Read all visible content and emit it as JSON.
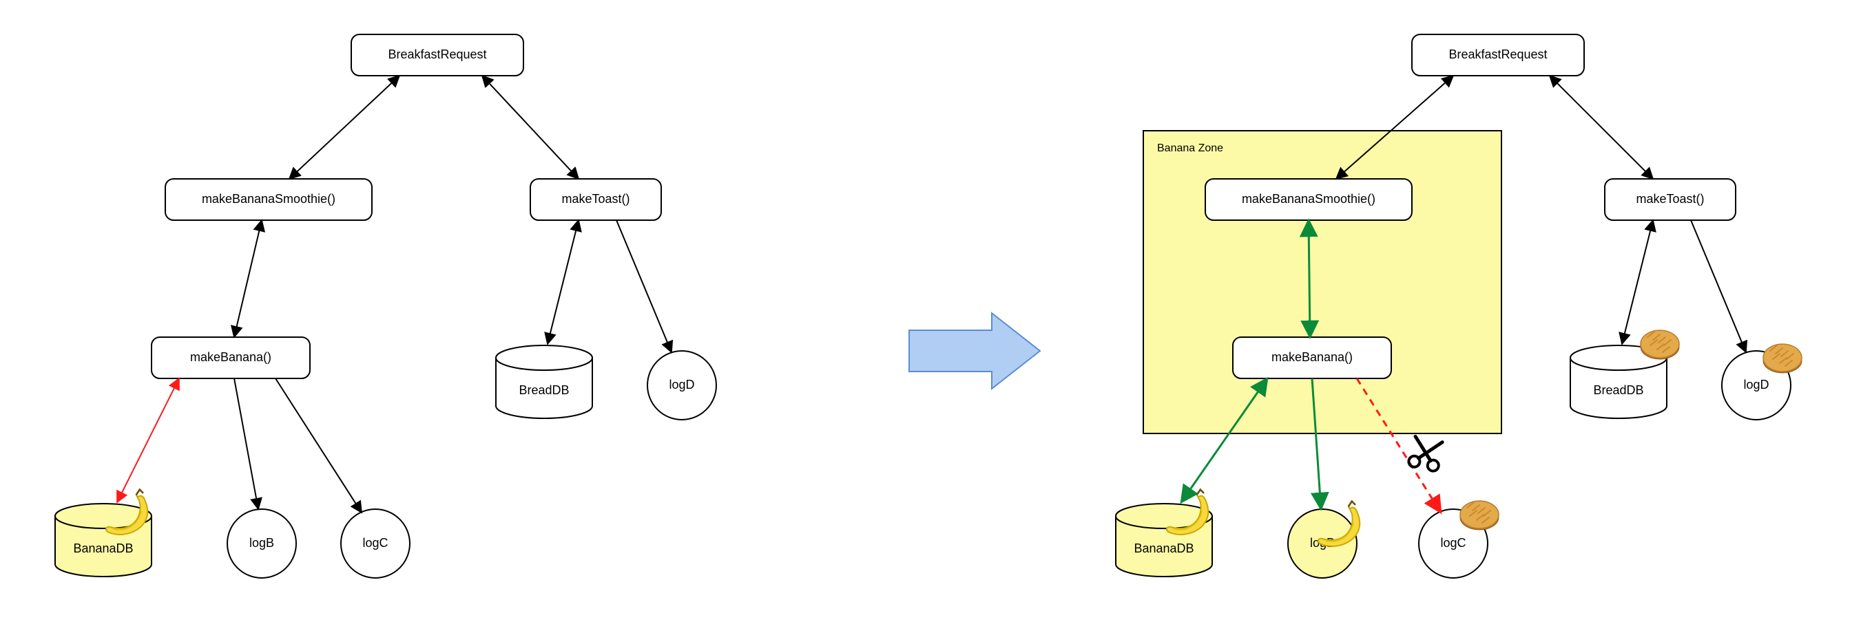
{
  "diagram": {
    "left": {
      "root": "BreakfastRequest",
      "smoothie": "makeBananaSmoothie()",
      "toast": "makeToast()",
      "banana": "makeBanana()",
      "bananaDB": "BananaDB",
      "logB": "logB",
      "logC": "logC",
      "breadDB": "BreadDB",
      "logD": "logD"
    },
    "right": {
      "zone": "Banana Zone",
      "root": "BreakfastRequest",
      "smoothie": "makeBananaSmoothie()",
      "toast": "makeToast()",
      "banana": "makeBanana()",
      "bananaDB": "BananaDB",
      "logB": "logB",
      "logC": "logC",
      "breadDB": "BreadDB",
      "logD": "logD"
    },
    "icons": {
      "banana": "banana-icon",
      "bread": "bread-icon",
      "scissors": "scissors-icon"
    },
    "colors": {
      "zone_fill": "#fdfaa7",
      "arrow_red": "#ff1a1a",
      "arrow_green": "#0b8a3a",
      "transition_arrow": "#b0cdf3"
    },
    "edges_left": [
      {
        "from": "root",
        "to": "smoothie",
        "style": "bidir-black"
      },
      {
        "from": "root",
        "to": "toast",
        "style": "bidir-black"
      },
      {
        "from": "smoothie",
        "to": "banana",
        "style": "bidir-black"
      },
      {
        "from": "banana",
        "to": "bananaDB",
        "style": "bidir-red"
      },
      {
        "from": "banana",
        "to": "logB",
        "style": "single-black"
      },
      {
        "from": "banana",
        "to": "logC",
        "style": "single-black"
      },
      {
        "from": "toast",
        "to": "breadDB",
        "style": "bidir-black"
      },
      {
        "from": "toast",
        "to": "logD",
        "style": "single-black"
      }
    ],
    "edges_right": [
      {
        "from": "root",
        "to": "smoothie",
        "style": "bidir-black"
      },
      {
        "from": "root",
        "to": "toast",
        "style": "bidir-black"
      },
      {
        "from": "smoothie",
        "to": "banana",
        "style": "bidir-green"
      },
      {
        "from": "banana",
        "to": "bananaDB",
        "style": "bidir-green"
      },
      {
        "from": "banana",
        "to": "logB",
        "style": "single-green"
      },
      {
        "from": "banana",
        "to": "logC",
        "style": "dashed-red-cut"
      },
      {
        "from": "toast",
        "to": "breadDB",
        "style": "bidir-black"
      },
      {
        "from": "toast",
        "to": "logD",
        "style": "single-black"
      }
    ]
  }
}
